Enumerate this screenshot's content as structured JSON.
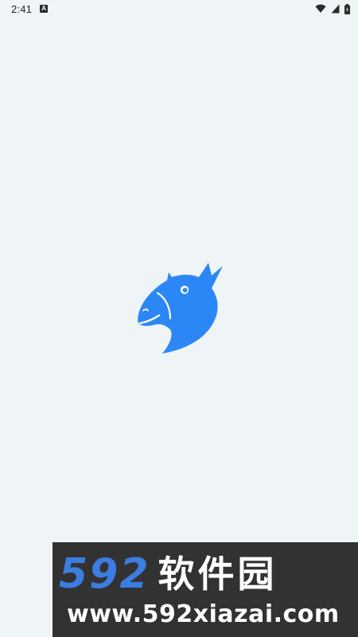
{
  "status_bar": {
    "time": "2:41",
    "notification_badge": "A",
    "icons": [
      "wifi-icon",
      "signal-icon",
      "battery-icon"
    ]
  },
  "splash": {
    "logo": "donkey-head-logo-icon",
    "accent_color": "#2b87f5",
    "background_color": "#eff4f7"
  },
  "watermark": {
    "number": "592",
    "chinese": "软件园",
    "url": "www.592xiazai.com",
    "number_color": "#3b7de0"
  }
}
